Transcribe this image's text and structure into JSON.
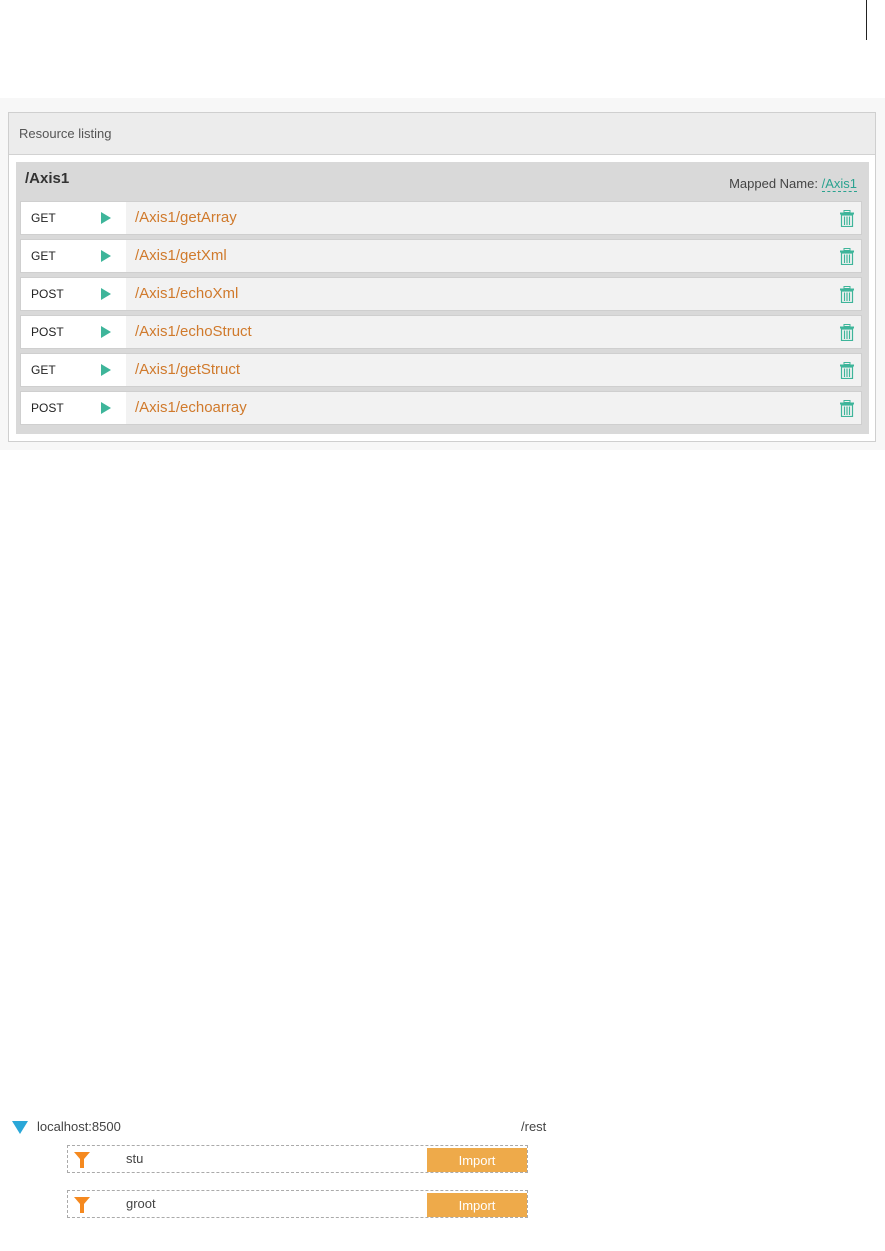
{
  "resource_listing": {
    "header": "Resource listing",
    "resource": {
      "title": "/Axis1",
      "mapped_label": "Mapped Name:",
      "mapped_value": "/Axis1"
    },
    "operations": [
      {
        "method": "GET",
        "path": "/Axis1/getArray"
      },
      {
        "method": "GET",
        "path": "/Axis1/getXml"
      },
      {
        "method": "POST",
        "path": "/Axis1/echoXml"
      },
      {
        "method": "POST",
        "path": "/Axis1/echoStruct"
      },
      {
        "method": "GET",
        "path": "/Axis1/getStruct"
      },
      {
        "method": "POST",
        "path": "/Axis1/echoarray"
      }
    ]
  },
  "server": {
    "host": "localhost:8500",
    "path": "/rest",
    "items": [
      {
        "name": "stu",
        "button": "Import"
      },
      {
        "name": "groot",
        "button": "Import"
      }
    ]
  },
  "colors": {
    "accent_green": "#3eb59a",
    "path_orange": "#d07a2c",
    "import_orange": "#eeaa4a",
    "expand_blue": "#2aa7d8"
  }
}
